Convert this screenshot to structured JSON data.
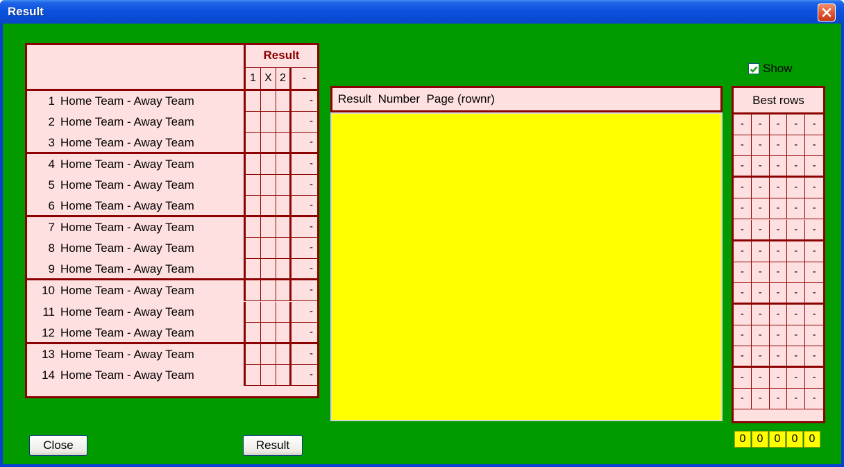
{
  "window": {
    "title": "Result"
  },
  "left_grid": {
    "header_title": "Result",
    "columns": [
      "1",
      "X",
      "2",
      "-"
    ],
    "rows": [
      {
        "num": "1",
        "teams": "Home Team - Away Team",
        "value": "-"
      },
      {
        "num": "2",
        "teams": "Home Team - Away Team",
        "value": "-"
      },
      {
        "num": "3",
        "teams": "Home Team - Away Team",
        "value": "-"
      },
      {
        "num": "4",
        "teams": "Home Team - Away Team",
        "value": "-"
      },
      {
        "num": "5",
        "teams": "Home Team - Away Team",
        "value": "-"
      },
      {
        "num": "6",
        "teams": "Home Team - Away Team",
        "value": "-"
      },
      {
        "num": "7",
        "teams": "Home Team - Away Team",
        "value": "-"
      },
      {
        "num": "8",
        "teams": "Home Team - Away Team",
        "value": "-"
      },
      {
        "num": "9",
        "teams": "Home Team - Away Team",
        "value": "-"
      },
      {
        "num": "10",
        "teams": "Home Team - Away Team",
        "value": "-"
      },
      {
        "num": "11",
        "teams": "Home Team - Away Team",
        "value": "-"
      },
      {
        "num": "12",
        "teams": "Home Team - Away Team",
        "value": "-"
      },
      {
        "num": "13",
        "teams": "Home Team - Away Team",
        "value": "-"
      },
      {
        "num": "14",
        "teams": "Home Team - Away Team",
        "value": "-"
      }
    ]
  },
  "middle": {
    "header": "Result  Number  Page (rownr)"
  },
  "right_grid": {
    "show_label": "Show",
    "show_checked": true,
    "header": "Best rows",
    "cell_value": "-",
    "totals": [
      "0",
      "0",
      "0",
      "0",
      "0"
    ]
  },
  "buttons": {
    "close": "Close",
    "result": "Result"
  },
  "colors": {
    "background": "#019b00",
    "grid_border": "#8b0000",
    "grid_fill": "#ffe0e0",
    "result_area": "#ffff00",
    "title_bar": "#0a52de"
  },
  "icons": {
    "close": "close-icon",
    "checkbox": "checkmark-icon"
  }
}
